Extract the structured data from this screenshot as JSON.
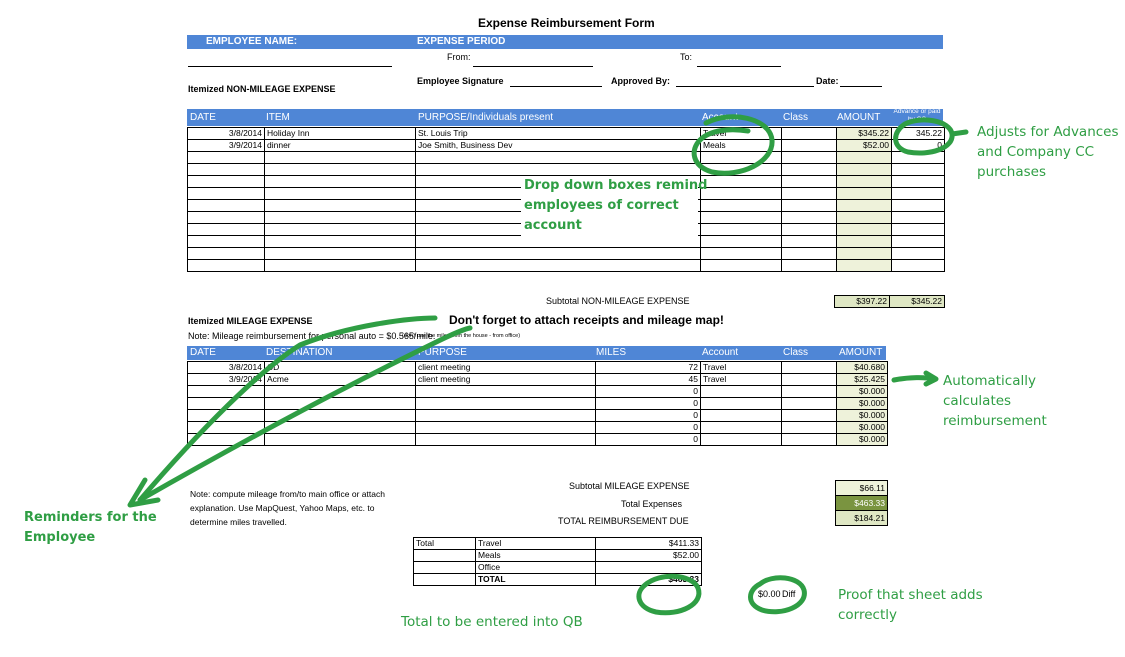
{
  "form": {
    "title": "Expense Reimbursement Form",
    "employee_name_label": "EMPLOYEE NAME:",
    "expense_period_label": "EXPENSE PERIOD",
    "from_label": "From:",
    "to_label": "To:",
    "signature_label": "Employee Signature",
    "approved_by_label": "Approved By:",
    "date_label": "Date:"
  },
  "non_mileage": {
    "section_label": "Itemized NON-MILEAGE EXPENSE",
    "headers": {
      "date": "DATE",
      "item": "ITEM",
      "purpose": "PURPOSE/Individuals present",
      "account": "Account",
      "class": "Class",
      "amount": "AMOUNT",
      "advance": "Advance or paid by CC"
    },
    "rows": [
      {
        "date": "3/8/2014",
        "item": "Holiday Inn",
        "purpose": "St. Louis Trip",
        "account": "Travel",
        "class": "",
        "amount": "$345.22",
        "advance": "345.22"
      },
      {
        "date": "3/9/2014",
        "item": "dinner",
        "purpose": "Joe Smith, Business Dev",
        "account": "Meals",
        "class": "",
        "amount": "$52.00",
        "advance": "0"
      }
    ],
    "subtotal_label": "Subtotal NON-MILEAGE EXPENSE",
    "subtotal_amount": "$397.22",
    "subtotal_advance": "$345.22"
  },
  "mileage": {
    "section_label": "Itemized MILEAGE EXPENSE",
    "reminder": "Don't forget to attach receipts and mileage map!",
    "note": "Note: Mileage reimbursement for personal auto = $0.565/mile.",
    "note_small": "(don't use the miles from the house - from office)",
    "headers": {
      "date": "DATE",
      "destination": "DESTINATION",
      "purpose": "PURPOSE",
      "miles": "MILES",
      "account": "Account",
      "class": "Class",
      "amount": "AMOUNT"
    },
    "rows": [
      {
        "date": "3/8/2014",
        "destination": "CD",
        "purpose": "client meeting",
        "miles": "72",
        "account": "Travel",
        "class": "",
        "amount": "$40.680"
      },
      {
        "date": "3/9/2014",
        "destination": "Acme",
        "purpose": "client meeting",
        "miles": "45",
        "account": "Travel",
        "class": "",
        "amount": "$25.425"
      },
      {
        "date": "",
        "destination": "",
        "purpose": "",
        "miles": "0",
        "account": "",
        "class": "",
        "amount": "$0.000"
      },
      {
        "date": "",
        "destination": "",
        "purpose": "",
        "miles": "0",
        "account": "",
        "class": "",
        "amount": "$0.000"
      },
      {
        "date": "",
        "destination": "",
        "purpose": "",
        "miles": "0",
        "account": "",
        "class": "",
        "amount": "$0.000"
      },
      {
        "date": "",
        "destination": "",
        "purpose": "",
        "miles": "0",
        "account": "",
        "class": "",
        "amount": "$0.000"
      },
      {
        "date": "",
        "destination": "",
        "purpose": "",
        "miles": "0",
        "account": "",
        "class": "",
        "amount": "$0.000"
      }
    ],
    "subtotal_label": "Subtotal MILEAGE EXPENSE",
    "subtotal_amount": "$66.11",
    "total_expenses_label": "Total Expenses",
    "total_expenses": "$463.33",
    "reimbursement_label": "TOTAL REIMBURSEMENT DUE",
    "reimbursement": "$184.21",
    "compute_note_1": "Note: compute mileage from/to main office or attach",
    "compute_note_2": "explanation. Use MapQuest, Yahoo Maps, etc. to",
    "compute_note_3": "determine miles travelled."
  },
  "summary": {
    "total_label": "Total",
    "rows": [
      {
        "label": "Travel",
        "value": "$411.33"
      },
      {
        "label": "Meals",
        "value": "$52.00"
      },
      {
        "label": "Office",
        "value": ""
      },
      {
        "label": "TOTAL",
        "value": "$463.33"
      }
    ],
    "diff_value": "$0.00",
    "diff_label": "Diff"
  },
  "annotations": {
    "advances_1": "Adjusts for Advances",
    "advances_2": "and Company CC",
    "advances_3": "purchases",
    "dropdown_1": "Drop down boxes remind",
    "dropdown_2": "employees of correct",
    "dropdown_3": "account",
    "auto_1": "Automatically",
    "auto_2": "calculates",
    "auto_3": "reimbursement",
    "reminders_1": "Reminders for the",
    "reminders_2": "Employee",
    "proof_1": "Proof that sheet adds",
    "proof_2": "correctly",
    "qb": "Total to be entered into QB"
  },
  "colors": {
    "header_blue": "#4f86d6",
    "annotation_green": "#2f9e44",
    "amount_fill": "#eef2da",
    "total_fill": "#7a9440"
  }
}
